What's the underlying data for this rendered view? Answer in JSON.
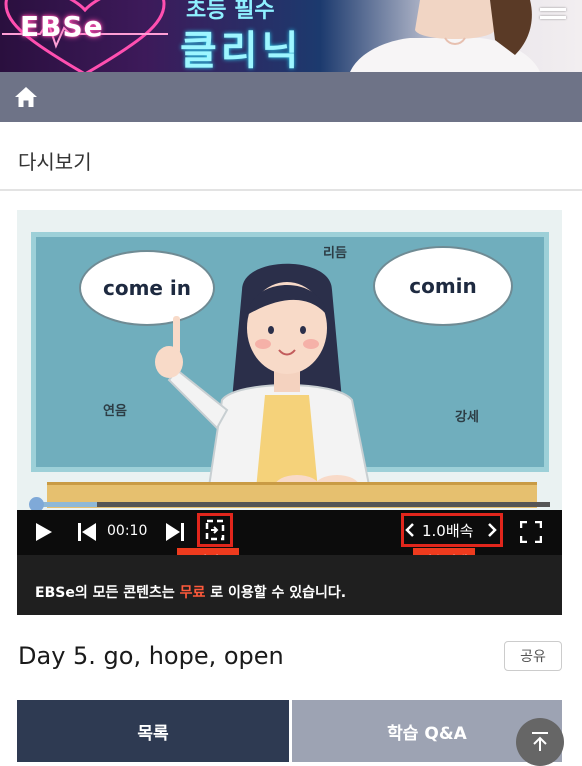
{
  "banner": {
    "logo_text": "EBSe",
    "title_top": "초등 필수",
    "title_main": "클리닉",
    "menu_icon": "hamburger-menu-icon"
  },
  "homebar": {
    "icon": "home-icon"
  },
  "section": {
    "title": "다시보기"
  },
  "video": {
    "bubble_left": "come in",
    "bubble_right": "comin",
    "label_rhythm": "리듬",
    "label_linking": "연음",
    "label_stress": "강세"
  },
  "player": {
    "time": "00:10",
    "progress_fraction": 0.12,
    "speed": "1.0배속",
    "repeat_tag": "구간반복",
    "speed_tag": "배속재생",
    "notice_pre": "EBSe의 모든 콘텐츠는 ",
    "notice_highlight": "무료",
    "notice_post": " 로 이용할 수 있습니다.",
    "highlight_color": "#e1261c"
  },
  "lesson": {
    "title": "Day 5. go, hope, open",
    "share_label": "공유"
  },
  "buttons": {
    "list_label": "목록",
    "qa_label": "학습 Q&A"
  },
  "colors": {
    "homebar": "#6e7387",
    "list_button": "#2e3a52",
    "qa_button": "#9da3b3"
  }
}
